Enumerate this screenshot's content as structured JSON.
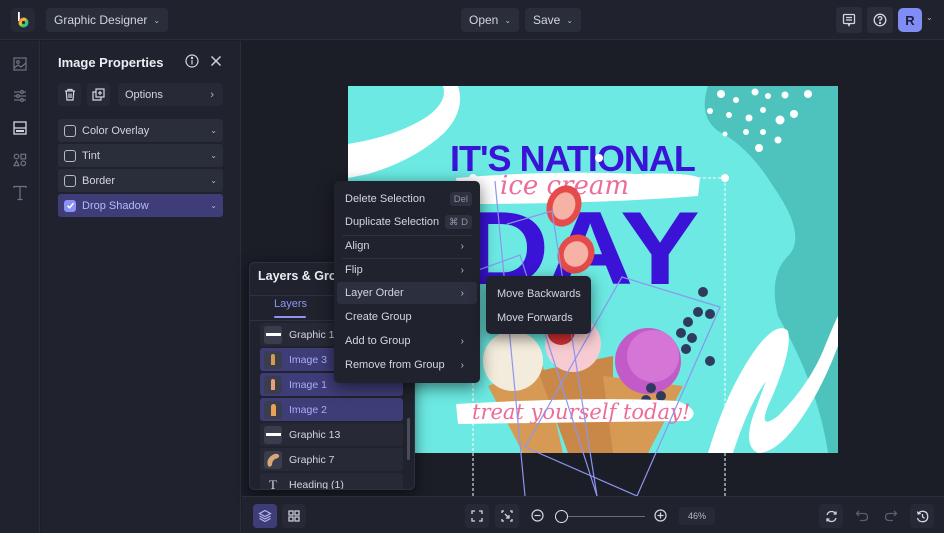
{
  "topbar": {
    "app_name": "Graphic Designer",
    "open_label": "Open",
    "save_label": "Save",
    "avatar_initial": "R",
    "icons": [
      "logo-icon",
      "comment-icon",
      "help-icon"
    ]
  },
  "rail": {
    "items": [
      {
        "name": "image-icon",
        "active": false
      },
      {
        "name": "adjustments-icon",
        "active": false
      },
      {
        "name": "layout-icon",
        "active": true
      },
      {
        "name": "shapes-icon",
        "active": false
      },
      {
        "name": "text-icon",
        "active": false
      }
    ]
  },
  "properties": {
    "title": "Image Properties",
    "options_label": "Options",
    "rows": [
      {
        "label": "Color Overlay",
        "checked": false
      },
      {
        "label": "Tint",
        "checked": false
      },
      {
        "label": "Border",
        "checked": false
      },
      {
        "label": "Drop Shadow",
        "checked": true
      }
    ]
  },
  "layers": {
    "title": "Layers & Groups",
    "tab": "Layers",
    "items": [
      {
        "label": "Graphic 10",
        "selected": false,
        "thumb": "bar"
      },
      {
        "label": "Image 3",
        "selected": true,
        "thumb": "cone"
      },
      {
        "label": "Image 1",
        "selected": true,
        "thumb": "cone"
      },
      {
        "label": "Image 2",
        "selected": true,
        "thumb": "cone"
      },
      {
        "label": "Graphic 13",
        "selected": false,
        "thumb": "bar"
      },
      {
        "label": "Graphic 7",
        "selected": false,
        "thumb": "blob"
      },
      {
        "label": "Heading (1)",
        "selected": false,
        "thumb": "text"
      }
    ]
  },
  "context_menu": {
    "items": [
      {
        "label": "Delete Selection",
        "shortcut": "Del"
      },
      {
        "label": "Duplicate Selection",
        "shortcut": "⌘ D"
      },
      {
        "label": "Align",
        "submenu": true
      },
      {
        "label": "Flip",
        "submenu": true
      },
      {
        "label": "Layer Order",
        "submenu": true,
        "highlighted": true
      },
      {
        "label": "Create Group"
      },
      {
        "label": "Add to Group",
        "submenu": true
      },
      {
        "label": "Remove from Group",
        "submenu": true
      }
    ],
    "submenu": {
      "items": [
        "Move Backwards",
        "Move Forwards"
      ]
    }
  },
  "artboard": {
    "headline_top": "IT'S NATIONAL",
    "headline_script": "ice cream",
    "headline_bottom": "DAY",
    "tagline": "treat yourself today!",
    "colors": {
      "background": "#6be9e2",
      "shape_dark": "#4ec3bd",
      "headline": "#3a13d6",
      "script": "#ec6c9a",
      "white": "#ffffff",
      "selection": "#8d95f0"
    }
  },
  "bottombar": {
    "zoom_percent": "46%",
    "zoom_value": 0.05
  },
  "theme": {
    "accent": "#8a93f5",
    "selected_bg": "#3e3d78",
    "panel_bg": "#20222d",
    "app_bg": "#1b1d27"
  }
}
